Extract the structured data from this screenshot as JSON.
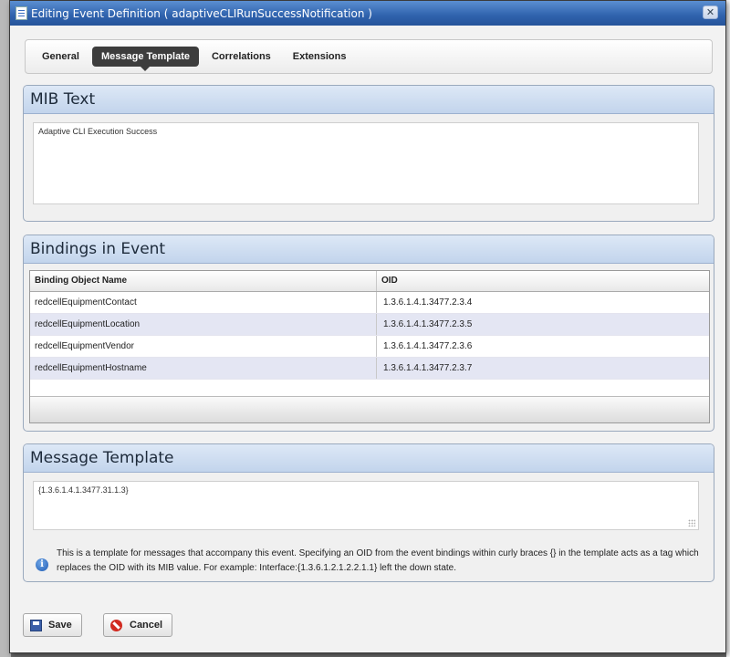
{
  "window": {
    "title": "Editing Event Definition ( adaptiveCLIRunSuccessNotification )",
    "close_glyph": "✕"
  },
  "tabs": [
    {
      "label": "General",
      "active": false
    },
    {
      "label": "Message Template",
      "active": true
    },
    {
      "label": "Correlations",
      "active": false
    },
    {
      "label": "Extensions",
      "active": false
    }
  ],
  "mib": {
    "heading": "MIB Text",
    "text": "Adaptive CLI Execution Success"
  },
  "bindings": {
    "heading": "Bindings in Event",
    "columns": [
      "Binding Object Name",
      "OID"
    ],
    "rows": [
      {
        "name": "redcellEquipmentContact",
        "oid": "1.3.6.1.4.1.3477.2.3.4"
      },
      {
        "name": "redcellEquipmentLocation",
        "oid": "1.3.6.1.4.1.3477.2.3.5"
      },
      {
        "name": "redcellEquipmentVendor",
        "oid": "1.3.6.1.4.1.3477.2.3.6"
      },
      {
        "name": "redcellEquipmentHostname",
        "oid": "1.3.6.1.4.1.3477.2.3.7"
      }
    ]
  },
  "template": {
    "heading": "Message Template",
    "value": "{1.3.6.1.4.1.3477.31.1.3}",
    "info_icon": "info-icon",
    "info_text": "This is a template for messages that accompany this event. Specifying an OID from the event bindings within curly braces {} in the template acts as a tag which replaces the OID with its MIB value. For example: Interface:{1.3.6.1.2.1.2.2.1.1} left the down state."
  },
  "buttons": {
    "save_label": "Save",
    "save_icon": "floppy-disk-icon",
    "cancel_label": "Cancel",
    "cancel_icon": "cancel-icon"
  },
  "colors": {
    "titlebar": "#2f62ad",
    "active_tab": "#3d3d3d",
    "panel_header": "#c2d4ec",
    "alt_row": "#e4e6f3"
  }
}
